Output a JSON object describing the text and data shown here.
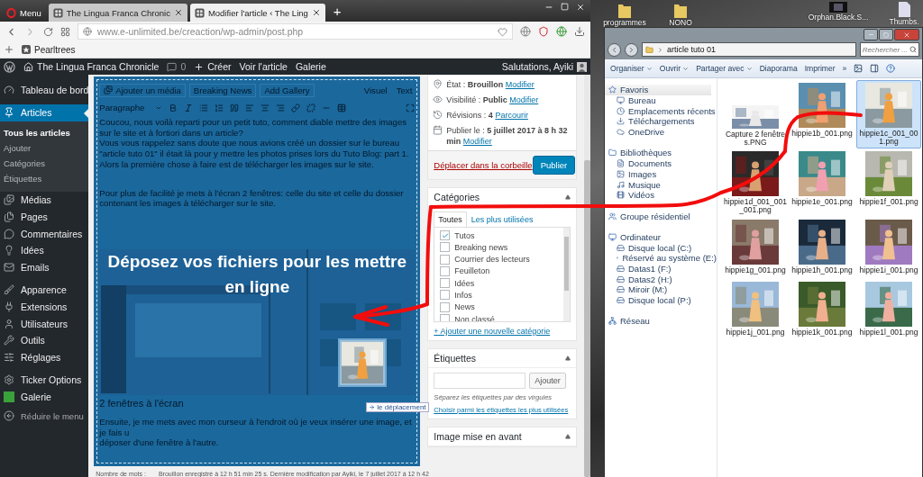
{
  "browser": {
    "tabs": [
      {
        "label": "Menu",
        "kind": "menu",
        "selected": false
      },
      {
        "label": "The Lingua Franca Chronic",
        "kind": "page",
        "selected": false
      },
      {
        "label": "Modifier l'article ‹ The Ling",
        "kind": "page",
        "selected": true
      }
    ],
    "new_tab": "+",
    "url": "www.e-unlimited.be/creaction/wp-admin/post.php",
    "bookmarks": [
      "Pearltrees"
    ]
  },
  "admin_bar": {
    "site": "The Lingua Franca Chronicle",
    "comments": "0",
    "create": "Créer",
    "links": [
      "Voir l'article",
      "Galerie"
    ],
    "greeting": "Salutations, Ayiki"
  },
  "sidebar": {
    "groups": [
      [
        {
          "label": "Tableau de bord",
          "selected": false
        }
      ],
      [
        {
          "label": "Articles",
          "selected": true,
          "children": [
            {
              "label": "Tous les articles",
              "selected": true
            },
            {
              "label": "Ajouter",
              "selected": false
            },
            {
              "label": "Catégories",
              "selected": false
            },
            {
              "label": "Étiquettes",
              "selected": false
            }
          ]
        },
        {
          "label": "Médias",
          "selected": false
        },
        {
          "label": "Pages",
          "selected": false
        },
        {
          "label": "Commentaires",
          "selected": false
        },
        {
          "label": "Idées",
          "selected": false
        },
        {
          "label": "Emails",
          "selected": false
        }
      ],
      [
        {
          "label": "Apparence",
          "selected": false
        },
        {
          "label": "Extensions",
          "selected": false
        },
        {
          "label": "Utilisateurs",
          "selected": false
        },
        {
          "label": "Outils",
          "selected": false
        },
        {
          "label": "Réglages",
          "selected": false
        }
      ],
      [
        {
          "label": "Ticker Options",
          "selected": false
        },
        {
          "label": "Galerie",
          "selected": false
        }
      ]
    ],
    "collapse": "Réduire le menu"
  },
  "editor": {
    "buttons": [
      "Ajouter un média",
      "Breaking News",
      "Add Gallery"
    ],
    "modes": [
      "Visuel",
      "Text"
    ],
    "format": "Paragraphe",
    "paragraphs": [
      "Coucou, nous voilà reparti pour un petit tuto, comment diable mettre des images sur le site et à fortiori dans un article?",
      "Vous vous rappelez sans doute que nous avions créé un dossier sur le bureau \"article tuto 01\" il était là pour y mettre les photos prises lors du Tuto Blog: part 1.",
      "Alors la première chose à faire est de télécharger les images sur le site.",
      "Pour plus de facilité je mets à l'écran 2 fenêtres: celle du site et celle du dossier contenant les images à télécharger sur le site."
    ],
    "heading": "2 fenêtres à l'écran",
    "after": [
      "Ensuite, je me mets avec mon curseur à l'endroit où je veux insérer une image, et je fais u",
      "déposer d'une fenêtre à l'autre."
    ],
    "drop_message": "Déposez vos fichiers pour les mettre en ligne",
    "drag_tooltip": "le déplacement",
    "footer": {
      "word_count": "Nombre de mots :",
      "saved": "Brouillon enregistré à 12 h 51 min 25 s. Dernière modification par Ayiki, le 7 juillet 2017 à 12 h 42"
    }
  },
  "publish": {
    "rows": [
      {
        "label": "État :",
        "value": "Brouillon",
        "link": "Modifier"
      },
      {
        "label": "Visibilité :",
        "value": "Public",
        "link": "Modifier"
      },
      {
        "label": "Révisions :",
        "value": "4",
        "link": "Parcourir"
      },
      {
        "label": "Publier le :",
        "value": "5 juillet 2017 à 8 h 32 min",
        "link": "Modifier"
      }
    ],
    "trash": "Déplacer dans la corbeille",
    "button": "Publier"
  },
  "categories": {
    "title": "Catégories",
    "tabs": [
      {
        "label": "Toutes",
        "selected": true
      },
      {
        "label": "Les plus utilisées",
        "selected": false
      }
    ],
    "items": [
      {
        "label": "Tutos",
        "checked": true
      },
      {
        "label": "Breaking news",
        "checked": false
      },
      {
        "label": "Courrier des lecteurs",
        "checked": false
      },
      {
        "label": "Feuilleton",
        "checked": false
      },
      {
        "label": "Idées",
        "checked": false
      },
      {
        "label": "Infos",
        "checked": false
      },
      {
        "label": "News",
        "checked": false
      },
      {
        "label": "Non classé",
        "checked": false
      }
    ],
    "add_link": "+ Ajouter une nouvelle catégorie"
  },
  "tags": {
    "title": "Étiquettes",
    "button": "Ajouter",
    "hint": "Séparez les étiquettes par des virgules",
    "link": "Choisir parmi les étiquettes les plus utilisées"
  },
  "featured": {
    "title": "Image mise en avant"
  },
  "desktop_icons": [
    {
      "label": "programmes",
      "kind": "folder"
    },
    {
      "label": "NONO",
      "kind": "folder"
    },
    {
      "label": "Orphan.Black.S...",
      "kind": "video"
    },
    {
      "label": "Thumbs.",
      "kind": "file"
    }
  ],
  "explorer": {
    "path": "article tuto 01",
    "search_placeholder": "Rechercher ...",
    "toolbar": [
      {
        "label": "Organiser",
        "menu": true
      },
      {
        "label": "Ouvrir",
        "menu": true
      },
      {
        "label": "Partager avec",
        "menu": true
      },
      {
        "label": "Diaporama",
        "menu": false
      },
      {
        "label": "Imprimer",
        "menu": false
      }
    ],
    "more": "»",
    "nav": [
      {
        "label": "Favoris",
        "selected": true,
        "children": [
          {
            "label": "Bureau"
          },
          {
            "label": "Emplacements récents"
          },
          {
            "label": "Téléchargements"
          },
          {
            "label": "OneDrive"
          }
        ]
      },
      {
        "label": "Bibliothèques",
        "selected": false,
        "children": [
          {
            "label": "Documents"
          },
          {
            "label": "Images"
          },
          {
            "label": "Musique"
          },
          {
            "label": "Vidéos"
          }
        ]
      },
      {
        "label": "Groupe résidentiel",
        "selected": false
      },
      {
        "label": "Ordinateur",
        "selected": false,
        "children": [
          {
            "label": "Disque local (C:)"
          },
          {
            "label": "Réservé au système (E:)"
          },
          {
            "label": "Datas1 (F:)"
          },
          {
            "label": "Datas2 (H:)"
          },
          {
            "label": "Miroir (M:)"
          },
          {
            "label": "Disque local (P:)"
          }
        ]
      },
      {
        "label": "Réseau",
        "selected": false
      }
    ],
    "files": [
      {
        "name": "Capture 2 fenêtres.PNG",
        "selected": false
      },
      {
        "name": "hippie1b_001.png",
        "selected": false
      },
      {
        "name": "hippie1c_001_001.png",
        "selected": true
      },
      {
        "name": "hippie1d_001_001_001.png",
        "selected": false
      },
      {
        "name": "hippie1e_001.png",
        "selected": false
      },
      {
        "name": "hippie1f_001.png",
        "selected": false
      },
      {
        "name": "hippie1g_001.png",
        "selected": false
      },
      {
        "name": "hippie1h_001.png",
        "selected": false
      },
      {
        "name": "hippie1i_001.png",
        "selected": false
      },
      {
        "name": "hippie1j_001.png",
        "selected": false
      },
      {
        "name": "hippie1k_001.png",
        "selected": false
      },
      {
        "name": "hippie1l_001.png",
        "selected": false
      }
    ]
  }
}
